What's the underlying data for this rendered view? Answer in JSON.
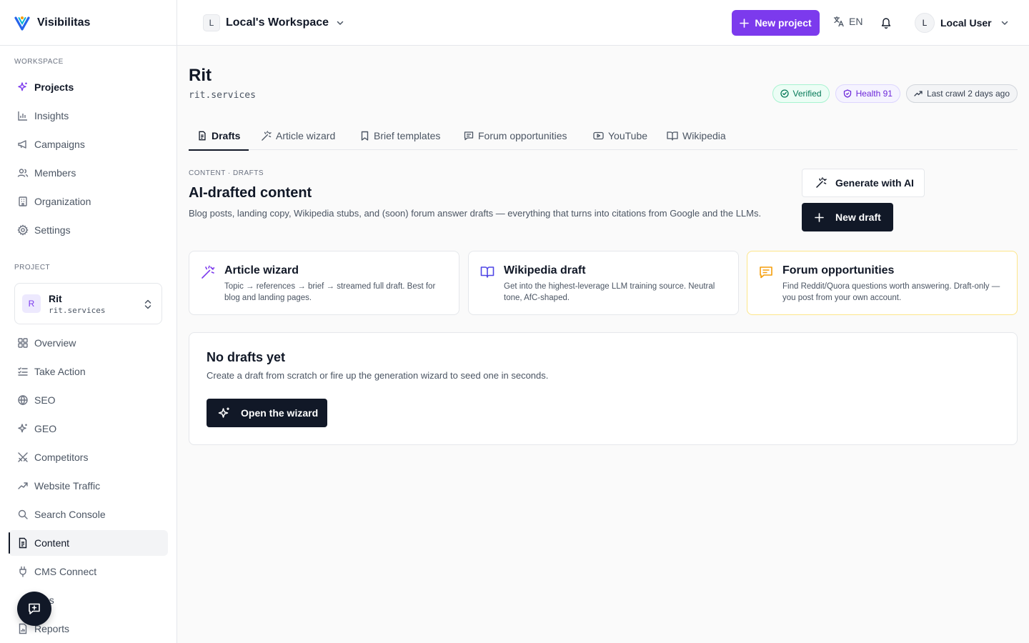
{
  "brand": {
    "name": "Visibilitas"
  },
  "sidebar": {
    "workspace_label": "WORKSPACE",
    "workspace_items": [
      {
        "label": "Projects",
        "icon": "sparkles-icon"
      },
      {
        "label": "Insights",
        "icon": "bar-chart-icon"
      },
      {
        "label": "Campaigns",
        "icon": "megaphone-icon"
      },
      {
        "label": "Members",
        "icon": "users-icon"
      },
      {
        "label": "Organization",
        "icon": "building-icon"
      },
      {
        "label": "Settings",
        "icon": "gear-icon"
      }
    ],
    "project_label": "PROJECT",
    "project_card": {
      "initial": "R",
      "name": "Rit",
      "domain": "rit.services"
    },
    "project_items": [
      {
        "label": "Overview",
        "icon": "grid-icon"
      },
      {
        "label": "Take Action",
        "icon": "checklist-icon"
      },
      {
        "label": "SEO",
        "icon": "globe-icon"
      },
      {
        "label": "GEO",
        "icon": "sparkles-icon"
      },
      {
        "label": "Competitors",
        "icon": "swords-icon"
      },
      {
        "label": "Website Traffic",
        "icon": "trending-up-icon"
      },
      {
        "label": "Search Console",
        "icon": "search-icon"
      },
      {
        "label": "Content",
        "icon": "document-icon"
      },
      {
        "label": "CMS Connect",
        "icon": "plug-icon"
      },
      {
        "label": "es",
        "icon": "none"
      },
      {
        "label": "Reports",
        "icon": "report-icon"
      }
    ]
  },
  "topbar": {
    "workspace_initial": "L",
    "workspace_name": "Local's Workspace",
    "new_project_label": "New project",
    "language": "EN",
    "user_initial": "L",
    "user_name": "Local User"
  },
  "project": {
    "title": "Rit",
    "domain": "rit.services",
    "badges": {
      "verified": "Verified",
      "health": "Health 91",
      "last_crawl": "Last crawl 2 days ago"
    }
  },
  "tabs": [
    {
      "label": "Drafts",
      "active": true
    },
    {
      "label": "Article wizard"
    },
    {
      "label": "Brief templates"
    },
    {
      "label": "Forum opportunities"
    },
    {
      "label": "YouTube"
    },
    {
      "label": "Wikipedia"
    }
  ],
  "content": {
    "eyebrow": "CONTENT · DRAFTS",
    "title": "AI-drafted content",
    "description": "Blog posts, landing copy, Wikipedia stubs, and (soon) forum answer drafts — everything that turns into citations from Google and the LLMs.",
    "generate_label": "Generate with AI",
    "new_draft_label": "New draft"
  },
  "cards": [
    {
      "title": "Article wizard",
      "description": "Topic → references → brief → streamed full draft. Best for blog and landing pages."
    },
    {
      "title": "Wikipedia draft",
      "description": "Get into the highest-leverage LLM training source. Neutral tone, AfC-shaped."
    },
    {
      "title": "Forum opportunities",
      "description": "Find Reddit/Quora questions worth answering. Draft-only — you post from your own account."
    }
  ],
  "empty_state": {
    "title": "No drafts yet",
    "description": "Create a draft from scratch or fire up the generation wizard to seed one in seconds.",
    "button_label": "Open the wizard"
  },
  "colors": {
    "accent": "#7c3aed",
    "dark": "#111827",
    "green": "#047857",
    "amber": "#f59e0b"
  }
}
